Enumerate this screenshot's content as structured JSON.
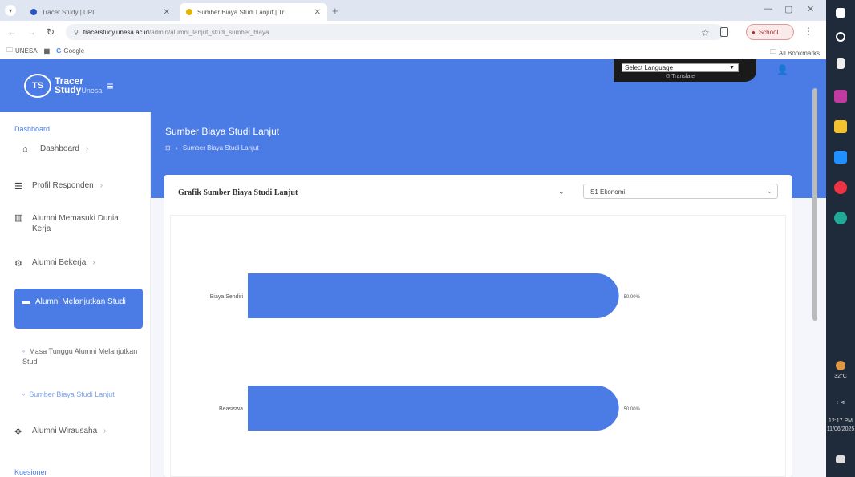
{
  "browser": {
    "tabs": [
      {
        "label": "Tracer Study | UPI",
        "active": false
      },
      {
        "label": "Sumber Biaya Studi Lanjut | Tr",
        "active": true
      }
    ],
    "url_host": "tracerstudy.unesa.ac.id",
    "url_path": "/admin/alumni_lanjut_studi_sumber_biaya",
    "profile_label": "School",
    "bookmarks": [
      "UNESA",
      "Google"
    ],
    "all_bookmarks": "All Bookmarks"
  },
  "sidebar": {
    "logo": {
      "ts": "TS",
      "line1": "Tracer",
      "line2": "Study",
      "unesa": "Unesa"
    },
    "section_dashboard": "Dashboard",
    "items": [
      {
        "label": "Dashboard",
        "icon": "home-icon"
      },
      {
        "label": "Profil Responden",
        "icon": "profile-icon"
      },
      {
        "label": "Alumni Memasuki Dunia Kerja",
        "icon": "building-icon"
      },
      {
        "label": "Alumni Bekerja",
        "icon": "briefcase-icon"
      }
    ],
    "active": {
      "label": "Alumni Melanjutkan Studi",
      "icon": "book-icon"
    },
    "subitems": [
      "Masa Tunggu Alumni Melanjutkan Studi",
      "Sumber Biaya Studi Lanjut"
    ],
    "after_item": {
      "label": "Alumni Wirausaha",
      "icon": "handshake-icon"
    },
    "section_kuesioner": "Kuesioner"
  },
  "header": {
    "language_select": "Select Language",
    "translate": "Translate"
  },
  "page": {
    "title": "Sumber Biaya Studi Lanjut",
    "breadcrumb": "Sumber Biaya Studi Lanjut",
    "card_title": "Grafik Sumber Biaya Studi Lanjut",
    "filter_value": "S1 Ekonomi"
  },
  "chart_data": {
    "type": "bar",
    "orientation": "horizontal",
    "categories": [
      "Biaya Sendiri",
      "Beasiswa"
    ],
    "values": [
      50.0,
      50.0
    ],
    "value_labels": [
      "50.00%",
      "50.00%"
    ],
    "xlim": [
      0,
      100
    ],
    "grid": false,
    "color": "#4b7be5"
  },
  "taskbar": {
    "weather": "32°C",
    "time": "12:17 PM",
    "date": "11/06/2025"
  }
}
